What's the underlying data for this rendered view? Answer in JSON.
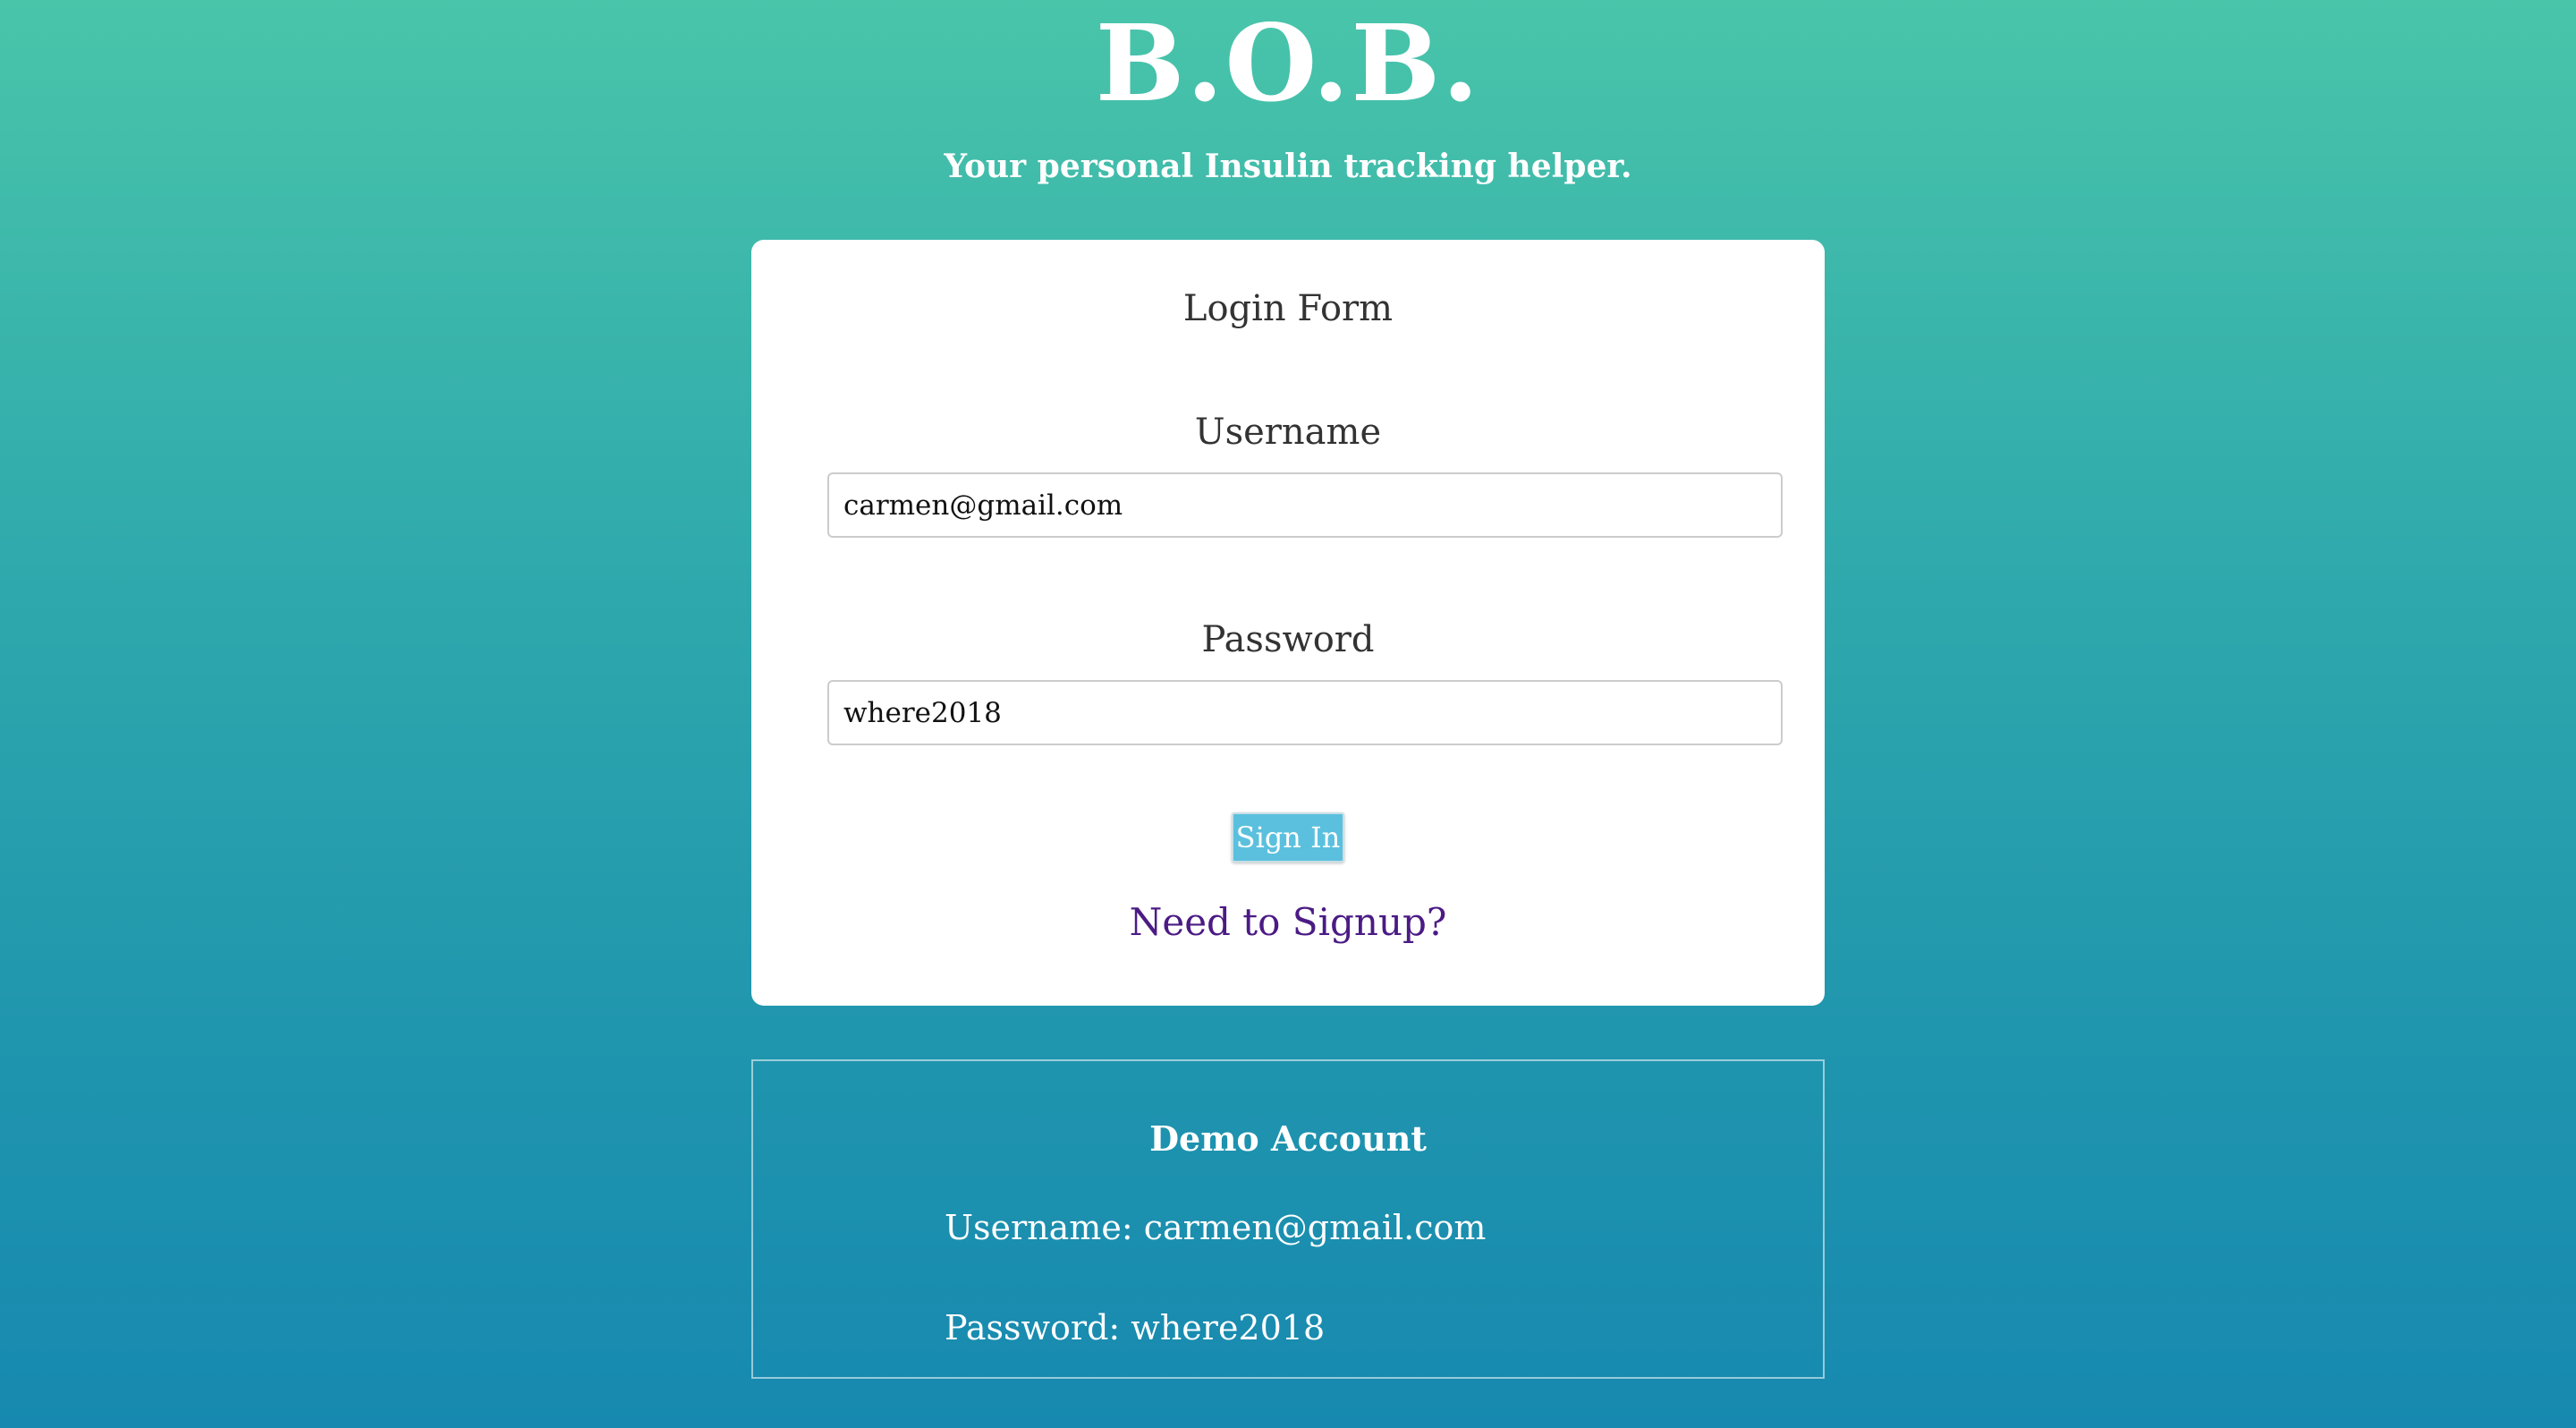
{
  "app": {
    "title": "B.O.B.",
    "subtitle": "Your personal Insulin tracking helper."
  },
  "login_form": {
    "title": "Login Form",
    "username_label": "Username",
    "username_value": "carmen@gmail.com",
    "password_label": "Password",
    "password_value": "where2018",
    "signin_label": "Sign In",
    "signup_link": "Need to Signup?"
  },
  "demo_account": {
    "title": "Demo Account",
    "username_line": "Username: carmen@gmail.com",
    "password_line": "Password: where2018"
  },
  "colors": {
    "gradient_top": "#49c5aa",
    "gradient_bottom": "#1789b0",
    "button_bg": "#5bc0de",
    "link": "#4b1b84"
  }
}
